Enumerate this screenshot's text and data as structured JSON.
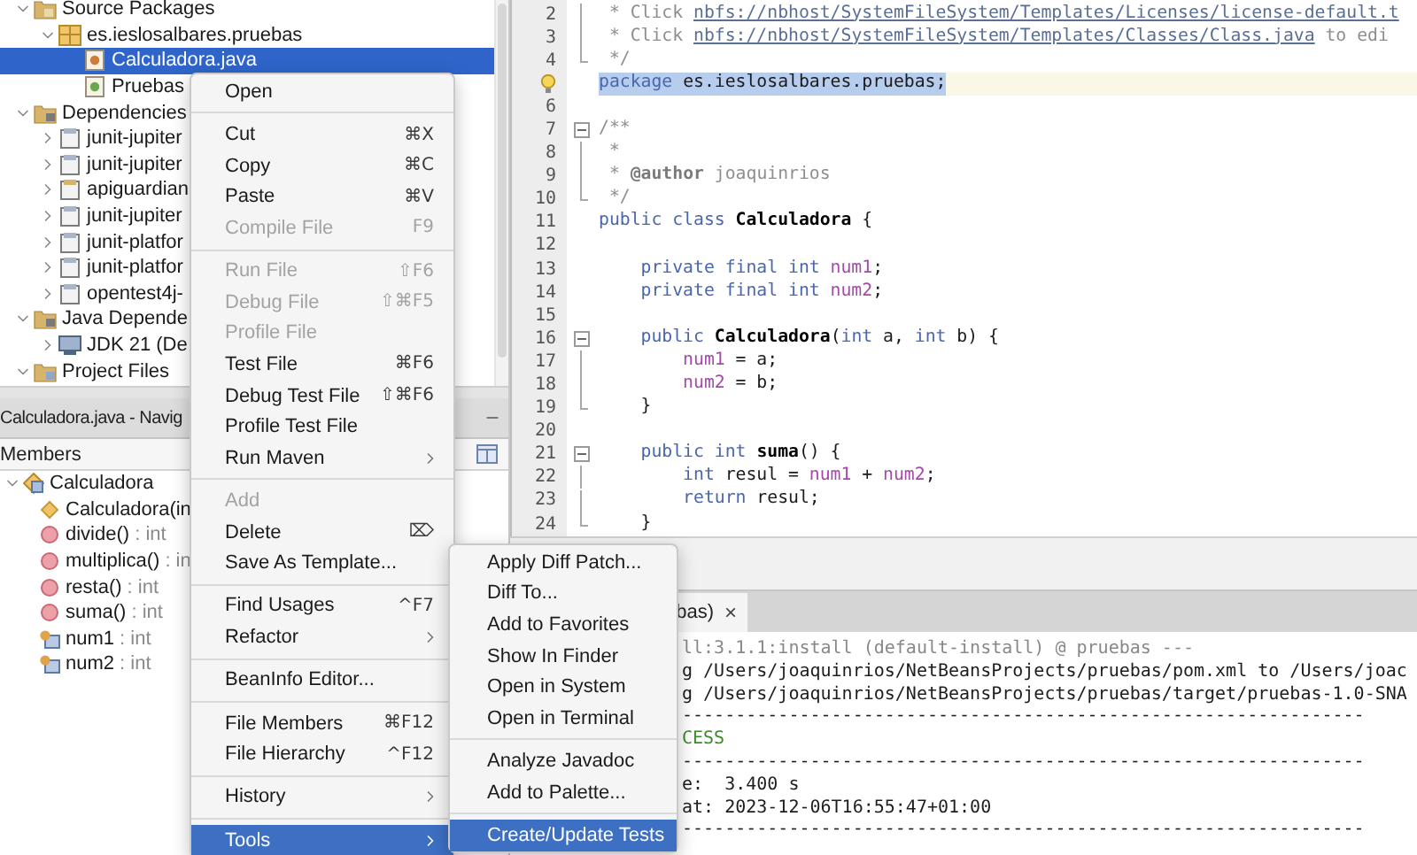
{
  "project_tree": [
    {
      "label": "Source Packages",
      "kind": "source_folder",
      "expanded": true,
      "selected": false,
      "children": [
        {
          "label": "es.ieslosalbares.pruebas",
          "kind": "package",
          "expanded": true,
          "selected": false,
          "children": [
            {
              "label": "Calculadora.java",
              "kind": "java_file",
              "selected": true
            },
            {
              "label": "Pruebas",
              "kind": "test_file",
              "selected": false
            }
          ]
        }
      ]
    },
    {
      "label": "Dependencies",
      "kind": "lib_folder",
      "expanded": true,
      "selected": false,
      "children": [
        {
          "label": "junit-jupiter",
          "kind": "jar",
          "expanded": false,
          "selected": false
        },
        {
          "label": "junit-jupiter",
          "kind": "jar",
          "expanded": false,
          "selected": false
        },
        {
          "label": "apiguardian",
          "kind": "jar_folder",
          "expanded": false,
          "selected": false
        },
        {
          "label": "junit-jupiter",
          "kind": "jar",
          "expanded": false,
          "selected": false
        },
        {
          "label": "junit-platfor",
          "kind": "jar",
          "expanded": false,
          "selected": false
        },
        {
          "label": "junit-platfor",
          "kind": "jar",
          "expanded": false,
          "selected": false
        },
        {
          "label": "opentest4j-",
          "kind": "jar",
          "expanded": false,
          "selected": false
        }
      ]
    },
    {
      "label": "Java Depende",
      "kind": "lib_folder",
      "expanded": true,
      "selected": false,
      "children": [
        {
          "label": "JDK 21 (De",
          "kind": "jdk",
          "expanded": false,
          "selected": false
        }
      ]
    },
    {
      "label": "Project Files",
      "kind": "config_folder",
      "expanded": true,
      "selected": false
    }
  ],
  "navigator": {
    "title": "Calculadora.java - Navig",
    "filter_label": "Members",
    "members": [
      {
        "name": "Calculadora",
        "kind": "class",
        "expanded": true,
        "children": [
          {
            "name": "Calculadora(in",
            "kind": "constructor"
          },
          {
            "name": "divide()",
            "type": ": int",
            "kind": "method"
          },
          {
            "name": "multiplica()",
            "type": ": in",
            "kind": "method"
          },
          {
            "name": "resta()",
            "type": ": int",
            "kind": "method"
          },
          {
            "name": "suma()",
            "type": ": int",
            "kind": "method"
          },
          {
            "name": "num1",
            "type": ": int",
            "kind": "field"
          },
          {
            "name": "num2",
            "type": ": int",
            "kind": "field"
          }
        ]
      }
    ]
  },
  "editor": {
    "lines": [
      {
        "number": "2",
        "fold_guide": true,
        "tokens": [
          {
            "text": " * Click ",
            "kind": "comment"
          },
          {
            "text": "nbfs://nbhost/SystemFileSystem/Templates/Licenses/license-default.t",
            "kind": "link"
          }
        ]
      },
      {
        "number": "3",
        "fold_guide": true,
        "tokens": [
          {
            "text": " * Click ",
            "kind": "comment"
          },
          {
            "text": "nbfs://nbhost/SystemFileSystem/Templates/Classes/Class.java",
            "kind": "link"
          },
          {
            "text": " to edi",
            "kind": "comment"
          }
        ]
      },
      {
        "number": "4",
        "fold_end": true,
        "tokens": [
          {
            "text": " */",
            "kind": "comment"
          }
        ]
      },
      {
        "hint": true,
        "selected": true,
        "tokens": [
          {
            "text": "package",
            "kind": "keyword"
          },
          {
            "text": " es.ieslosalbares.pruebas;",
            "kind": "plain"
          }
        ]
      },
      {
        "number": "6"
      },
      {
        "number": "7",
        "fold_toggle": true,
        "tokens": [
          {
            "text": "/**",
            "kind": "comment"
          }
        ]
      },
      {
        "number": "8",
        "fold_guide": true,
        "tokens": [
          {
            "text": " *",
            "kind": "comment"
          }
        ]
      },
      {
        "number": "9",
        "fold_guide": true,
        "tokens": [
          {
            "text": " * ",
            "kind": "comment"
          },
          {
            "text": "@author",
            "kind": "doctag"
          },
          {
            "text": " joaquinrios",
            "kind": "comment"
          }
        ]
      },
      {
        "number": "10",
        "fold_end": true,
        "tokens": [
          {
            "text": " */",
            "kind": "comment"
          }
        ]
      },
      {
        "number": "11",
        "tokens": [
          {
            "text": "public class ",
            "kind": "keyword"
          },
          {
            "text": "Calculadora",
            "kind": "bold"
          },
          {
            "text": " {",
            "kind": "plain"
          }
        ]
      },
      {
        "number": "12"
      },
      {
        "number": "13",
        "tokens": [
          {
            "text": "    private final int ",
            "kind": "keyword"
          },
          {
            "text": "num1",
            "kind": "field"
          },
          {
            "text": ";",
            "kind": "plain"
          }
        ]
      },
      {
        "number": "14",
        "tokens": [
          {
            "text": "    private final int ",
            "kind": "keyword"
          },
          {
            "text": "num2",
            "kind": "field"
          },
          {
            "text": ";",
            "kind": "plain"
          }
        ]
      },
      {
        "number": "15"
      },
      {
        "number": "16",
        "fold_toggle": true,
        "tokens": [
          {
            "text": "    public ",
            "kind": "keyword"
          },
          {
            "text": "Calculadora",
            "kind": "bold"
          },
          {
            "text": "(",
            "kind": "plain"
          },
          {
            "text": "int",
            "kind": "keyword"
          },
          {
            "text": " a, ",
            "kind": "plain"
          },
          {
            "text": "int",
            "kind": "keyword"
          },
          {
            "text": " b) {",
            "kind": "plain"
          }
        ]
      },
      {
        "number": "17",
        "fold_guide": true,
        "tokens": [
          {
            "text": "        num1",
            "kind": "field"
          },
          {
            "text": " = a;",
            "kind": "plain"
          }
        ]
      },
      {
        "number": "18",
        "fold_guide": true,
        "tokens": [
          {
            "text": "        num2",
            "kind": "field"
          },
          {
            "text": " = b;",
            "kind": "plain"
          }
        ]
      },
      {
        "number": "19",
        "fold_end": true,
        "tokens": [
          {
            "text": "    }",
            "kind": "plain"
          }
        ]
      },
      {
        "number": "20"
      },
      {
        "number": "21",
        "fold_toggle": true,
        "tokens": [
          {
            "text": "    public int ",
            "kind": "keyword"
          },
          {
            "text": "suma",
            "kind": "bold"
          },
          {
            "text": "() {",
            "kind": "plain"
          }
        ]
      },
      {
        "number": "22",
        "fold_guide": true,
        "tokens": [
          {
            "text": "        int",
            "kind": "keyword"
          },
          {
            "text": " resul = ",
            "kind": "plain"
          },
          {
            "text": "num1",
            "kind": "field"
          },
          {
            "text": " + ",
            "kind": "plain"
          },
          {
            "text": "num2",
            "kind": "field"
          },
          {
            "text": ";",
            "kind": "plain"
          }
        ]
      },
      {
        "number": "23",
        "fold_guide": true,
        "tokens": [
          {
            "text": "        return",
            "kind": "keyword"
          },
          {
            "text": " resul;",
            "kind": "plain"
          }
        ]
      },
      {
        "number": "24",
        "fold_end": true,
        "tokens": [
          {
            "text": "    }",
            "kind": "plain"
          }
        ]
      }
    ]
  },
  "output": {
    "tab": {
      "label": "bas)",
      "close": "×"
    },
    "lines": [
      {
        "text": "ll:3.1.1:install (default-install) @ pruebas ---",
        "kind": "muted"
      },
      {
        "text": "g /Users/joaquinrios/NetBeansProjects/pruebas/pom.xml to /Users/joac",
        "kind": "info"
      },
      {
        "text": "g /Users/joaquinrios/NetBeansProjects/pruebas/target/pruebas-1.0-SNA",
        "kind": "info"
      },
      {
        "text": "----------------------------------------------------------------",
        "kind": "info"
      },
      {
        "text": "CESS",
        "kind": "success"
      },
      {
        "text": "----------------------------------------------------------------",
        "kind": "info"
      },
      {
        "text": "e:  3.400 s",
        "kind": "info"
      },
      {
        "text": "at: 2023-12-06T16:55:47+01:00",
        "kind": "info"
      },
      {
        "text": "----------------------------------------------------------------",
        "kind": "info"
      }
    ]
  },
  "context_menu": {
    "groups": [
      [
        {
          "label": "Open",
          "disabled": false,
          "selected": false
        }
      ],
      [
        {
          "label": "Cut",
          "shortcut": "⌘X",
          "disabled": false,
          "selected": false
        },
        {
          "label": "Copy",
          "shortcut": "⌘C",
          "disabled": false,
          "selected": false
        },
        {
          "label": "Paste",
          "shortcut": "⌘V",
          "disabled": false,
          "selected": false
        },
        {
          "label": "Compile File",
          "shortcut": "F9",
          "disabled": true,
          "selected": false
        }
      ],
      [
        {
          "label": "Run File",
          "shortcut": "⇧F6",
          "disabled": true,
          "selected": false
        },
        {
          "label": "Debug File",
          "shortcut": "⇧⌘F5",
          "disabled": true,
          "selected": false
        },
        {
          "label": "Profile File",
          "disabled": true,
          "selected": false
        },
        {
          "label": "Test File",
          "shortcut": "⌘F6",
          "disabled": false,
          "selected": false
        },
        {
          "label": "Debug Test File",
          "shortcut": "⇧⌘F6",
          "disabled": false,
          "selected": false
        },
        {
          "label": "Profile Test File",
          "disabled": false,
          "selected": false
        },
        {
          "label": "Run Maven",
          "submenu": true,
          "disabled": false,
          "selected": false
        }
      ],
      [
        {
          "label": "Add",
          "disabled": true,
          "selected": false
        },
        {
          "label": "Delete",
          "shortcut": "⌦",
          "disabled": false,
          "selected": false
        },
        {
          "label": "Save As Template...",
          "disabled": false,
          "selected": false
        }
      ],
      [
        {
          "label": "Find Usages",
          "shortcut": "^F7",
          "disabled": false,
          "selected": false
        },
        {
          "label": "Refactor",
          "submenu": true,
          "disabled": false,
          "selected": false
        }
      ],
      [
        {
          "label": "BeanInfo Editor...",
          "disabled": false,
          "selected": false
        }
      ],
      [
        {
          "label": "File Members",
          "shortcut": "⌘F12",
          "disabled": false,
          "selected": false
        },
        {
          "label": "File Hierarchy",
          "shortcut": "^F12",
          "disabled": false,
          "selected": false
        }
      ],
      [
        {
          "label": "History",
          "submenu": true,
          "disabled": false,
          "selected": false
        }
      ],
      [
        {
          "label": "Tools",
          "submenu": true,
          "disabled": false,
          "selected": true
        }
      ]
    ]
  },
  "submenu": {
    "groups": [
      [
        {
          "label": "Apply Diff Patch...",
          "selected": false
        },
        {
          "label": "Diff To...",
          "selected": false
        },
        {
          "label": "Add to Favorites",
          "selected": false
        },
        {
          "label": "Show In Finder",
          "selected": false
        },
        {
          "label": "Open in System",
          "selected": false
        },
        {
          "label": "Open in Terminal",
          "selected": false
        }
      ],
      [
        {
          "label": "Analyze Javadoc",
          "selected": false
        },
        {
          "label": "Add to Palette...",
          "selected": false
        }
      ],
      [
        {
          "label": "Create/Update Tests",
          "selected": true
        }
      ]
    ]
  }
}
